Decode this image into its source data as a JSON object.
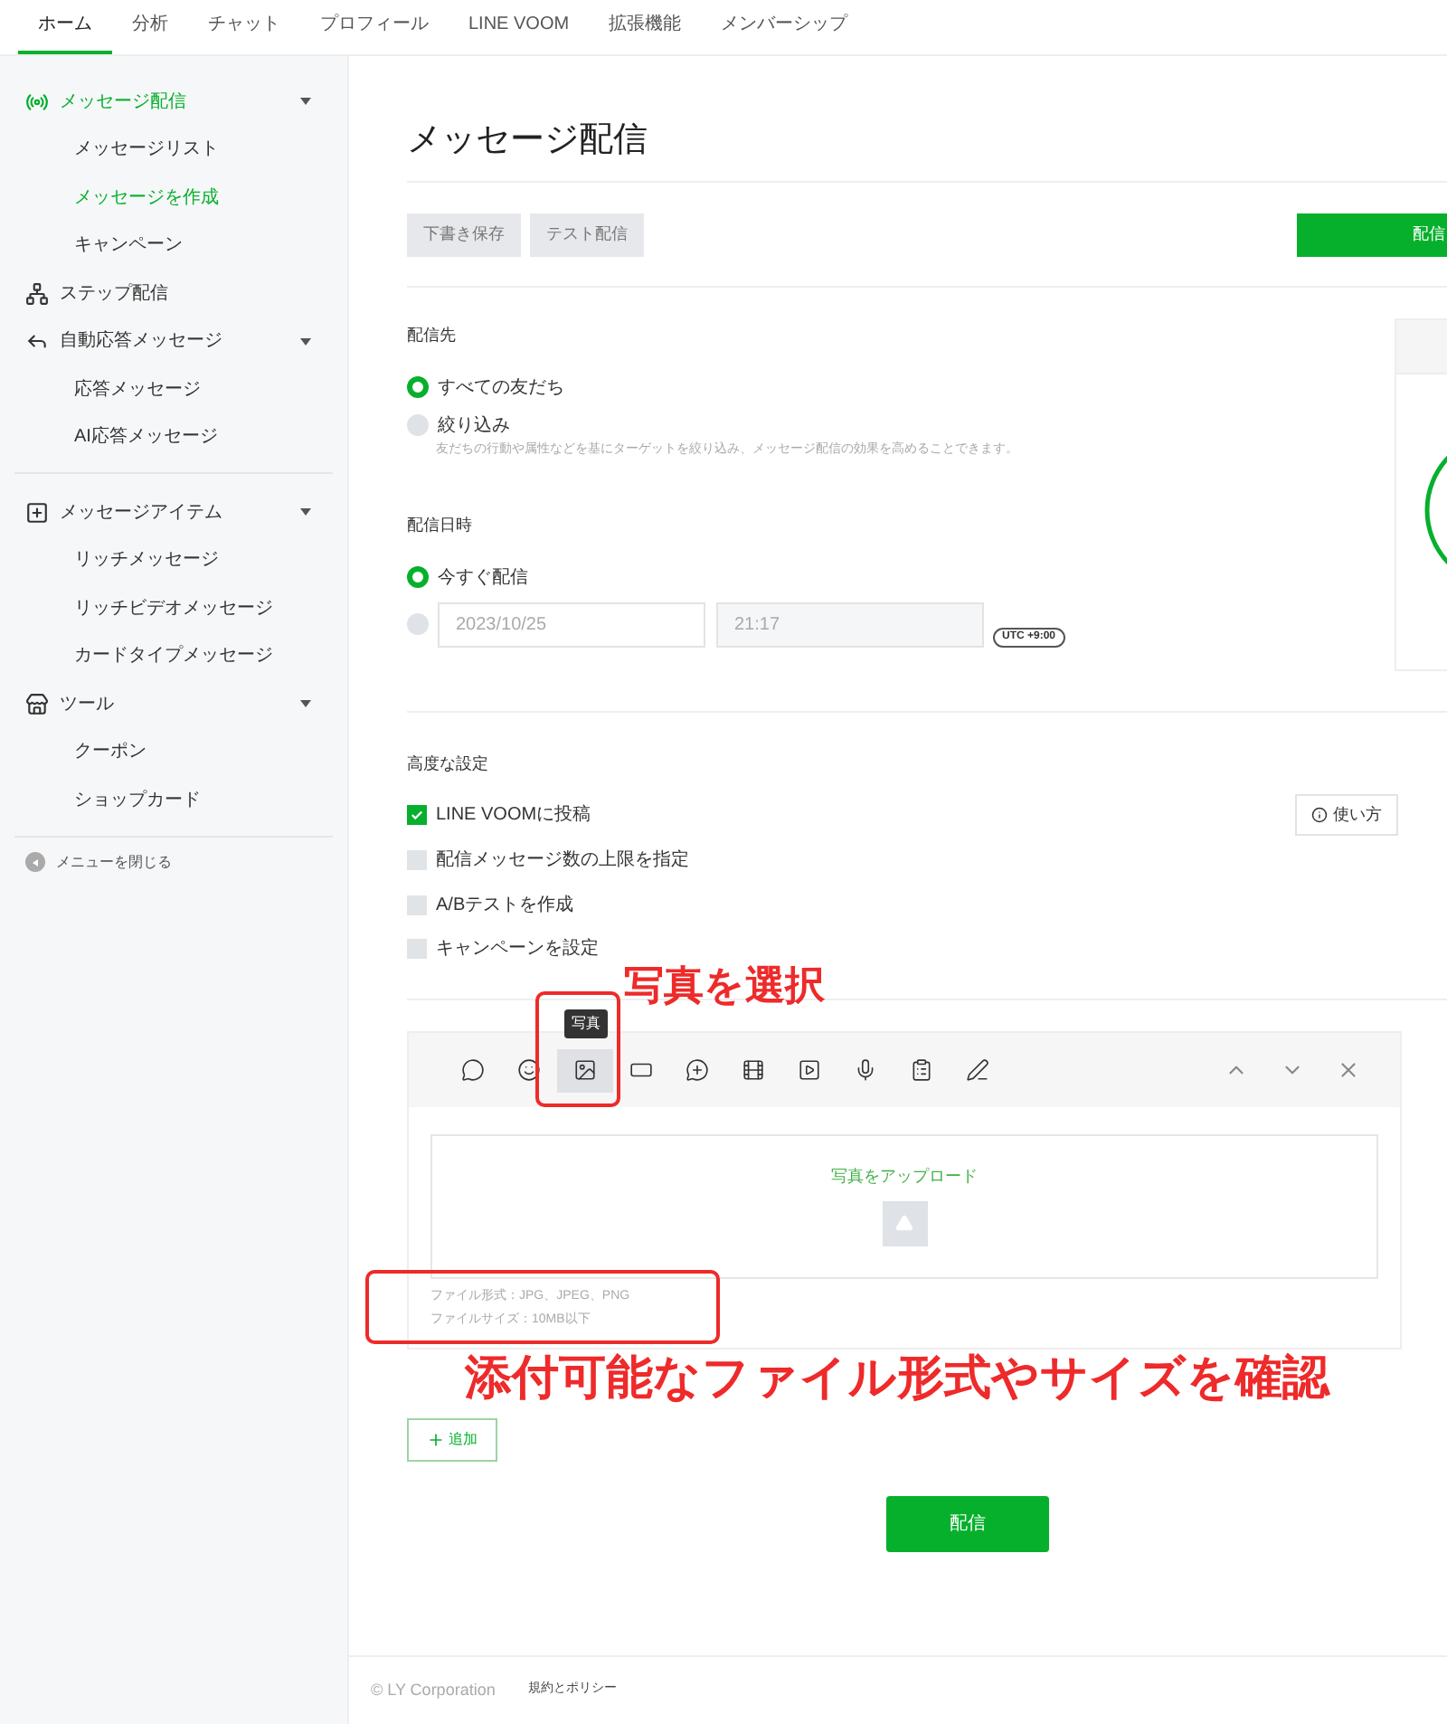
{
  "top_tabs": [
    {
      "label": "ホーム",
      "selected": true
    },
    {
      "label": "分析",
      "selected": false
    },
    {
      "label": "チャット",
      "selected": false
    },
    {
      "label": "プロフィール",
      "selected": false
    },
    {
      "label": "LINE VOOM",
      "selected": false
    },
    {
      "label": "拡張機能",
      "selected": false
    },
    {
      "label": "メンバーシップ",
      "selected": false
    }
  ],
  "sidebar": {
    "groups": [
      [
        {
          "kind": "broadcast",
          "label": "メッセージ配信",
          "selected": true,
          "expanded": true,
          "children": [
            {
              "label": "メッセージリスト",
              "selected": false
            },
            {
              "label": "メッセージを作成",
              "selected": true
            },
            {
              "label": "キャンペーン",
              "selected": false
            }
          ]
        },
        {
          "kind": "step",
          "label": "ステップ配信",
          "selected": false
        },
        {
          "kind": "reply",
          "label": "自動応答メッセージ",
          "selected": false,
          "expanded": true,
          "children": [
            {
              "label": "応答メッセージ",
              "selected": false
            },
            {
              "label": "AI応答メッセージ",
              "selected": false
            }
          ]
        }
      ],
      [
        {
          "kind": "item",
          "label": "メッセージアイテム",
          "selected": false,
          "expanded": true,
          "children": [
            {
              "label": "リッチメッセージ",
              "selected": false
            },
            {
              "label": "リッチビデオメッセージ",
              "selected": false
            },
            {
              "label": "カードタイプメッセージ",
              "selected": false
            }
          ]
        },
        {
          "kind": "tools",
          "label": "ツール",
          "selected": false,
          "expanded": true,
          "children": [
            {
              "label": "クーポン",
              "selected": false
            },
            {
              "label": "ショップカード",
              "selected": false
            }
          ]
        }
      ]
    ],
    "close_menu": "メニューを閉じる"
  },
  "page_title": "メッセージ配信",
  "actions": {
    "save_draft": "下書き保存",
    "test_send": "テスト配信",
    "send": "配信"
  },
  "recipients": {
    "label": "配信先",
    "options": [
      {
        "label": "すべての友だち",
        "selected": true
      },
      {
        "label": "絞り込み",
        "selected": false,
        "hint": "友だちの行動や属性などを基にターゲットを絞り込み、メッセージ配信の効果を高めることできます。"
      }
    ]
  },
  "schedule": {
    "label": "配信日時",
    "options": [
      {
        "kind": "text",
        "label": "今すぐ配信",
        "selected": true
      },
      {
        "kind": "datetime",
        "selected": false,
        "date": "2023/10/25",
        "time": "21:17",
        "timezone": "UTC +9:00"
      }
    ]
  },
  "advanced": {
    "label": "高度な設定",
    "help": "使い方",
    "options": [
      {
        "label": "LINE VOOMに投稿",
        "checked": true
      },
      {
        "label": "配信メッセージ数の上限を指定",
        "checked": false
      },
      {
        "label": "A/Bテストを作成",
        "checked": false
      },
      {
        "label": "キャンペーンを設定",
        "checked": false
      }
    ]
  },
  "editor": {
    "tools": [
      {
        "selected": false
      },
      {
        "selected": false
      },
      {
        "selected": true,
        "tooltip": "写真"
      },
      {
        "selected": false
      },
      {
        "selected": false
      },
      {
        "selected": false
      },
      {
        "selected": false
      },
      {
        "selected": false
      },
      {
        "selected": false
      },
      {
        "selected": false
      }
    ],
    "upload_label": "写真をアップロード",
    "file_info": [
      "ファイル形式：JPG、JPEG、PNG",
      "ファイルサイズ：10MB以下"
    ]
  },
  "add_button": "追加",
  "bottom_send": "配信",
  "footer": {
    "copyright": "© LY Corporation",
    "link": "規約とポリシー"
  },
  "annotations": [
    "写真を選択",
    "添付可能なファイル形式やサイズを確認"
  ]
}
